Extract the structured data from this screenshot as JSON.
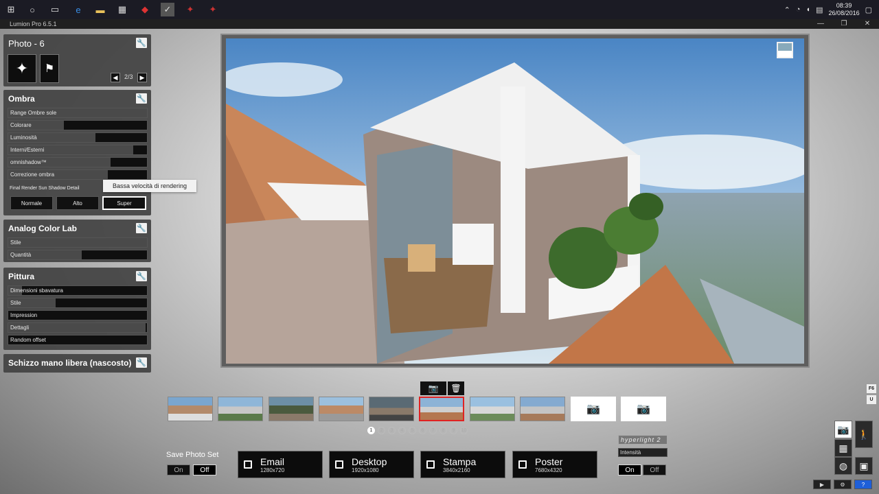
{
  "taskbar": {
    "time": "08:39",
    "date": "26/08/2016"
  },
  "window": {
    "title": "Lumion Pro 6.5.1"
  },
  "photo_panel": {
    "title": "Photo - 6",
    "page": "2/3",
    "effects": [
      {
        "icon": "sparkle-effect-icon"
      },
      {
        "icon": "figure-sparkle-icon"
      }
    ]
  },
  "ombra": {
    "title": "Ombra",
    "sliders": [
      {
        "label": "Range Ombre sole",
        "value": 1.0
      },
      {
        "label": "Colorare",
        "value": 0.4
      },
      {
        "label": "Luminosità",
        "value": 0.63
      },
      {
        "label": "Interni/Esterni",
        "value": 0.9
      },
      {
        "label": "omnishadow™",
        "value": 0.74
      },
      {
        "label": "Correzione ombra",
        "value": 0.72
      }
    ],
    "final_render_label": "Final Render Sun Shadow Detail",
    "quality_buttons": [
      "Normale",
      "Alto",
      "Super"
    ],
    "selected_quality": "Super",
    "tooltip": "Bassa velocità di rendering"
  },
  "analog": {
    "title": "Analog Color Lab",
    "sliders": [
      {
        "label": "Stile",
        "value": 1.0
      },
      {
        "label": "Quantità",
        "value": 0.53
      }
    ]
  },
  "pittura": {
    "title": "Pittura",
    "sliders": [
      {
        "label": "Dimensioni sbavatura",
        "value": 0.1
      },
      {
        "label": "Stile",
        "value": 0.34
      },
      {
        "label": "Impression",
        "value": 0.0
      },
      {
        "label": "Dettagli",
        "value": 0.99
      },
      {
        "label": "Random offset",
        "value": 0.0
      }
    ]
  },
  "schizzo": {
    "title": "Schizzo mano libera (nascosto)"
  },
  "strip": {
    "selected_index": 5,
    "thumb_count": 10,
    "pages": [
      "1",
      "2",
      "3",
      "4",
      "5",
      "6",
      "7",
      "8",
      "9",
      "10"
    ],
    "active_page": "1"
  },
  "save_photo_set": {
    "label": "Save Photo Set",
    "on": "On",
    "off": "Off",
    "selected": "Off"
  },
  "outputs": [
    {
      "title": "Email",
      "res": "1280x720"
    },
    {
      "title": "Desktop",
      "res": "1920x1080"
    },
    {
      "title": "Stampa",
      "res": "3840x2160"
    },
    {
      "title": "Poster",
      "res": "7680x4320"
    }
  ],
  "hyperlight": {
    "logo": "hyperlight 2",
    "intensity": "Intensità",
    "on": "On",
    "off": "Off",
    "selected": "On"
  },
  "side": {
    "f6": "F6",
    "u": "U"
  }
}
